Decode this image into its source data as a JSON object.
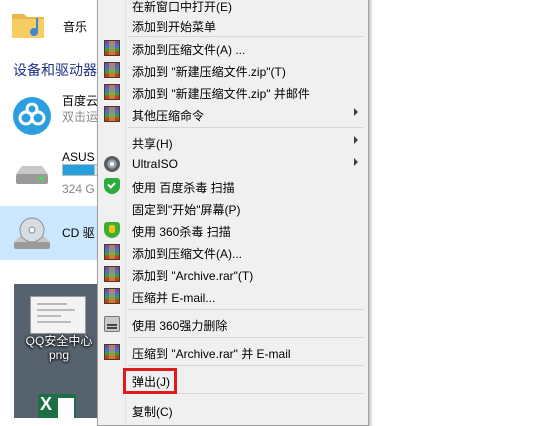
{
  "explorer": {
    "favorites_item_label": "音乐",
    "section_title": "设备和驱动器",
    "drives": [
      {
        "name": "百度云",
        "sub": "双击运"
      },
      {
        "name": "ASUS",
        "sub": "324 G",
        "used_fraction": 0.92
      },
      {
        "name": "CD 驱"
      }
    ],
    "desktop_items": [
      {
        "label_line1": "QQ安全中心",
        "label_line2": "png"
      }
    ]
  },
  "context_menu": {
    "items": [
      {
        "label": "在新窗口中打开(E)",
        "icon": "none"
      },
      {
        "label": "添加到开始菜单",
        "icon": "none"
      },
      {
        "label": "添加到压缩文件(A) ...",
        "icon": "winrar-icon"
      },
      {
        "label": "添加到 \"新建压缩文件.zip\"(T)",
        "icon": "winrar-icon"
      },
      {
        "label": "添加到 \"新建压缩文件.zip\" 并邮件",
        "icon": "winrar-icon"
      },
      {
        "label": "其他压缩命令",
        "icon": "winrar-icon",
        "submenu": true
      },
      {
        "label": "共享(H)",
        "icon": "none",
        "submenu": true
      },
      {
        "label": "UltraISO",
        "icon": "ultraiso-icon",
        "submenu": true
      },
      {
        "label": "使用 百度杀毒 扫描",
        "icon": "baidu-antivirus-icon"
      },
      {
        "label": "固定到\"开始\"屏幕(P)",
        "icon": "none"
      },
      {
        "label": "使用 360杀毒 扫描",
        "icon": "360-antivirus-icon"
      },
      {
        "label": "添加到压缩文件(A)...",
        "icon": "winrar-icon"
      },
      {
        "label": "添加到 \"Archive.rar\"(T)",
        "icon": "winrar-icon"
      },
      {
        "label": "压缩并 E-mail...",
        "icon": "winrar-icon"
      },
      {
        "label": "使用 360强力删除",
        "icon": "shredder-icon"
      },
      {
        "label": "压缩到 \"Archive.rar\" 并 E-mail",
        "icon": "winrar-icon"
      },
      {
        "label": "弹出(J)",
        "icon": "none",
        "highlighted": true
      },
      {
        "label": "复制(C)",
        "icon": "none"
      }
    ]
  },
  "colors": {
    "highlight_box": "#e01b1b",
    "menu_background": "#f0f0f0",
    "drive_bar": "#26a0da"
  }
}
